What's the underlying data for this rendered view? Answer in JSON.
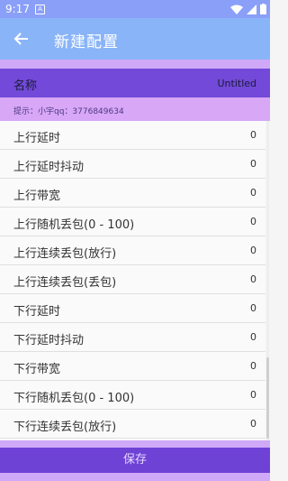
{
  "status_bar": {
    "time": "9:17",
    "notification_icon": "A",
    "icons": [
      "wifi-icon",
      "signal-icon",
      "battery-icon"
    ]
  },
  "app_bar": {
    "title": "新建配置",
    "back_icon": "arrow-left-icon"
  },
  "name_field": {
    "label": "名称",
    "value": "Untitled"
  },
  "hint": {
    "text": "提示：小宇qq：3776849634"
  },
  "rows": [
    {
      "label": "上行延时",
      "value": "0"
    },
    {
      "label": "上行延时抖动",
      "value": "0"
    },
    {
      "label": "上行带宽",
      "value": "0"
    },
    {
      "label": "上行随机丢包(0 - 100)",
      "value": "0"
    },
    {
      "label": "上行连续丢包(放行)",
      "value": "0"
    },
    {
      "label": "上行连续丢包(丢包)",
      "value": "0"
    },
    {
      "label": "下行延时",
      "value": "0"
    },
    {
      "label": "下行延时抖动",
      "value": "0"
    },
    {
      "label": "下行带宽",
      "value": "0"
    },
    {
      "label": "下行随机丢包(0 - 100)",
      "value": "0"
    },
    {
      "label": "下行连续丢包(放行)",
      "value": "0"
    }
  ],
  "save_button": {
    "label": "保存"
  },
  "colors": {
    "app_bar": "#8ab4f8",
    "accent": "#7249d8",
    "band": "#cfa9f7"
  }
}
